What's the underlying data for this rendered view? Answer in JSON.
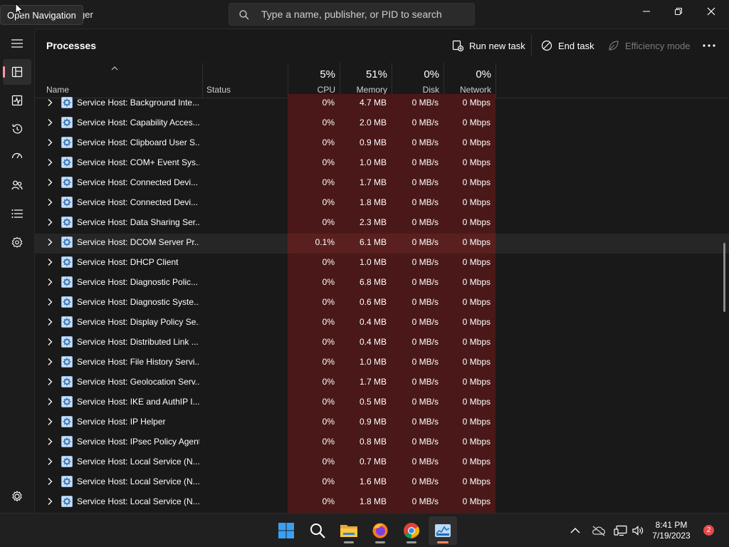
{
  "app": {
    "title_partial": "ger",
    "tooltip": "Open Navigation"
  },
  "search": {
    "placeholder": "Type a name, publisher, or PID to search"
  },
  "nav": {
    "items": [
      "processes-icon",
      "performance-icon",
      "app-history-icon",
      "startup-apps-icon",
      "users-icon",
      "details-icon",
      "services-icon"
    ],
    "active": "processes-icon",
    "settings": "settings-icon"
  },
  "page": {
    "title": "Processes"
  },
  "commands": {
    "run_new_task": "Run new task",
    "end_task": "End task",
    "efficiency_mode": "Efficiency mode"
  },
  "columns": {
    "name": "Name",
    "status": "Status",
    "cpu": {
      "pct": "5%",
      "label": "CPU"
    },
    "memory": {
      "pct": "51%",
      "label": "Memory"
    },
    "disk": {
      "pct": "0%",
      "label": "Disk"
    },
    "network": {
      "pct": "0%",
      "label": "Network"
    }
  },
  "processes": [
    {
      "name": "Service Host: Background Inte...",
      "cpu": "0%",
      "memory": "4.7 MB",
      "disk": "0 MB/s",
      "network": "0 Mbps"
    },
    {
      "name": "Service Host: Capability Acces...",
      "cpu": "0%",
      "memory": "2.0 MB",
      "disk": "0 MB/s",
      "network": "0 Mbps"
    },
    {
      "name": "Service Host: Clipboard User S...",
      "cpu": "0%",
      "memory": "0.9 MB",
      "disk": "0 MB/s",
      "network": "0 Mbps"
    },
    {
      "name": "Service Host: COM+ Event Sys...",
      "cpu": "0%",
      "memory": "1.0 MB",
      "disk": "0 MB/s",
      "network": "0 Mbps"
    },
    {
      "name": "Service Host: Connected Devi...",
      "cpu": "0%",
      "memory": "1.7 MB",
      "disk": "0 MB/s",
      "network": "0 Mbps"
    },
    {
      "name": "Service Host: Connected Devi...",
      "cpu": "0%",
      "memory": "1.8 MB",
      "disk": "0 MB/s",
      "network": "0 Mbps"
    },
    {
      "name": "Service Host: Data Sharing Ser...",
      "cpu": "0%",
      "memory": "2.3 MB",
      "disk": "0 MB/s",
      "network": "0 Mbps"
    },
    {
      "name": "Service Host: DCOM Server Pr...",
      "cpu": "0.1%",
      "memory": "6.1 MB",
      "disk": "0 MB/s",
      "network": "0 Mbps"
    },
    {
      "name": "Service Host: DHCP Client",
      "cpu": "0%",
      "memory": "1.0 MB",
      "disk": "0 MB/s",
      "network": "0 Mbps"
    },
    {
      "name": "Service Host: Diagnostic Polic...",
      "cpu": "0%",
      "memory": "6.8 MB",
      "disk": "0 MB/s",
      "network": "0 Mbps"
    },
    {
      "name": "Service Host: Diagnostic Syste...",
      "cpu": "0%",
      "memory": "0.6 MB",
      "disk": "0 MB/s",
      "network": "0 Mbps"
    },
    {
      "name": "Service Host: Display Policy Se...",
      "cpu": "0%",
      "memory": "0.4 MB",
      "disk": "0 MB/s",
      "network": "0 Mbps"
    },
    {
      "name": "Service Host: Distributed Link ...",
      "cpu": "0%",
      "memory": "0.4 MB",
      "disk": "0 MB/s",
      "network": "0 Mbps"
    },
    {
      "name": "Service Host: File History Servi...",
      "cpu": "0%",
      "memory": "1.0 MB",
      "disk": "0 MB/s",
      "network": "0 Mbps"
    },
    {
      "name": "Service Host: Geolocation Serv...",
      "cpu": "0%",
      "memory": "1.7 MB",
      "disk": "0 MB/s",
      "network": "0 Mbps"
    },
    {
      "name": "Service Host: IKE and AuthIP I...",
      "cpu": "0%",
      "memory": "0.5 MB",
      "disk": "0 MB/s",
      "network": "0 Mbps"
    },
    {
      "name": "Service Host: IP Helper",
      "cpu": "0%",
      "memory": "0.9 MB",
      "disk": "0 MB/s",
      "network": "0 Mbps"
    },
    {
      "name": "Service Host: IPsec Policy Agent",
      "cpu": "0%",
      "memory": "0.8 MB",
      "disk": "0 MB/s",
      "network": "0 Mbps"
    },
    {
      "name": "Service Host: Local Service (N...",
      "cpu": "0%",
      "memory": "0.7 MB",
      "disk": "0 MB/s",
      "network": "0 Mbps"
    },
    {
      "name": "Service Host: Local Service (N...",
      "cpu": "0%",
      "memory": "1.6 MB",
      "disk": "0 MB/s",
      "network": "0 Mbps"
    },
    {
      "name": "Service Host: Local Service (N...",
      "cpu": "0%",
      "memory": "1.8 MB",
      "disk": "0 MB/s",
      "network": "0 Mbps"
    }
  ],
  "highlighted_row": 7,
  "colors": {
    "usage_fill": "#4a1818",
    "usage_fill_hover": "#5a2020",
    "accent": "#ff99a4"
  },
  "taskbar": {
    "apps": [
      "windows-start-icon",
      "search-icon",
      "file-explorer-icon",
      "firefox-icon",
      "chrome-icon",
      "task-manager-icon"
    ],
    "active_app": "task-manager-icon",
    "time": "8:41 PM",
    "date": "7/19/2023",
    "notification_count": "2"
  }
}
